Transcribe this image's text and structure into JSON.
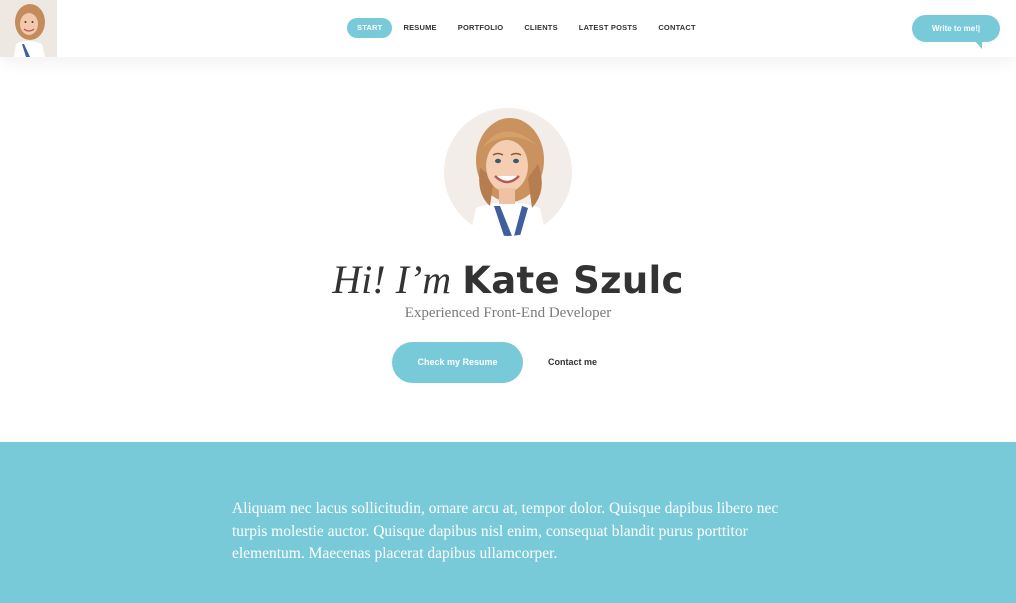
{
  "nav": {
    "items": [
      {
        "label": "START",
        "active": true
      },
      {
        "label": "RESUME",
        "active": false
      },
      {
        "label": "PORTFOLIO",
        "active": false
      },
      {
        "label": "CLIENTS",
        "active": false
      },
      {
        "label": "LATEST POSTS",
        "active": false
      },
      {
        "label": "CONTACT",
        "active": false
      }
    ]
  },
  "header": {
    "write_button": "Write to me!|"
  },
  "hero": {
    "greeting": "Hi! I’m",
    "name": "Kate Szulc",
    "subtitle": "Experienced Front-End Developer",
    "primary_button": "Check my Resume",
    "secondary_link": "Contact me"
  },
  "intro": {
    "text": "Aliquam nec lacus sollicitudin, ornare arcu at, tempor dolor. Quisque dapibus libero nec turpis molestie auctor. Quisque dapibus nisl enim, consequat blandit purus porttitor elementum. Maecenas placerat dapibus ullamcorper."
  },
  "colors": {
    "accent": "#78cad9",
    "text": "#333333",
    "muted": "#7a7a7a"
  }
}
